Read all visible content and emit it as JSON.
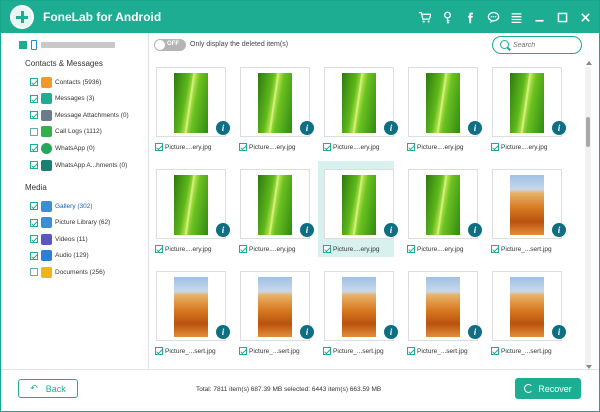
{
  "app": {
    "title": "FoneLab for Android"
  },
  "titlebar_icons": [
    "cart-icon",
    "key-icon",
    "facebook-icon",
    "chat-icon",
    "menu-icon",
    "minimize-icon",
    "maximize-icon",
    "close-icon"
  ],
  "colors": {
    "accent": "#1cad93",
    "info_badge": "#0e6e84",
    "highlight": "#d8f1ee"
  },
  "sidebar": {
    "contacts_header": "Contacts & Messages",
    "media_header": "Media",
    "contacts_items": [
      {
        "label": "Contacts (5936)",
        "icon": "contacts-icon",
        "checked": true
      },
      {
        "label": "Messages (3)",
        "icon": "messages-icon",
        "checked": true
      },
      {
        "label": "Message Attachments (0)",
        "icon": "attachment-icon",
        "checked": true
      },
      {
        "label": "Call Logs (1112)",
        "icon": "call-log-icon",
        "checked": false
      },
      {
        "label": "WhatsApp (0)",
        "icon": "whatsapp-icon",
        "checked": true
      },
      {
        "label": "WhatsApp A...hments (0)",
        "icon": "whatsapp-attachment-icon",
        "checked": true
      }
    ],
    "media_items": [
      {
        "label": "Gallery (302)",
        "icon": "gallery-icon",
        "checked": true,
        "selected": true
      },
      {
        "label": "Picture Library (62)",
        "icon": "picture-library-icon",
        "checked": true
      },
      {
        "label": "Videos (11)",
        "icon": "video-icon",
        "checked": true
      },
      {
        "label": "Audio (129)",
        "icon": "audio-icon",
        "checked": true
      },
      {
        "label": "Documents (256)",
        "icon": "documents-icon",
        "checked": false
      }
    ]
  },
  "topbar": {
    "toggle_state": "OFF",
    "toggle_label": "Only display the deleted item(s)",
    "search_placeholder": "Search"
  },
  "grid": {
    "tiles": [
      {
        "caption": "Picture....ery.jpg",
        "image": "leaf",
        "checked": true
      },
      {
        "caption": "Picture....ery.jpg",
        "image": "leaf",
        "checked": true
      },
      {
        "caption": "Picture....ery.jpg",
        "image": "leaf",
        "checked": true
      },
      {
        "caption": "Picture....ery.jpg",
        "image": "leaf",
        "checked": true
      },
      {
        "caption": "Picture....ery.jpg",
        "image": "leaf",
        "checked": true
      },
      {
        "caption": "Picture....ery.jpg",
        "image": "leaf",
        "checked": true
      },
      {
        "caption": "Picture....ery.jpg",
        "image": "leaf",
        "checked": true
      },
      {
        "caption": "Picture....ery.jpg",
        "image": "leaf",
        "checked": true,
        "highlighted": true
      },
      {
        "caption": "Picture....ery.jpg",
        "image": "leaf",
        "checked": true
      },
      {
        "caption": "Picture_...sert.jpg",
        "image": "desert",
        "checked": true
      },
      {
        "caption": "Picture_...sert.jpg",
        "image": "desert",
        "checked": true
      },
      {
        "caption": "Picture_...sert.jpg",
        "image": "desert",
        "checked": true
      },
      {
        "caption": "Picture_...sert.jpg",
        "image": "desert",
        "checked": true
      },
      {
        "caption": "Picture_...sert.jpg",
        "image": "desert",
        "checked": true
      },
      {
        "caption": "Picture_...sert.jpg",
        "image": "desert",
        "checked": true
      }
    ]
  },
  "footer": {
    "back_label": "Back",
    "stats": "Total: 7811 item(s) 687.39 MB   selected: 6443 item(s) 663.59 MB",
    "recover_label": "Recover"
  }
}
